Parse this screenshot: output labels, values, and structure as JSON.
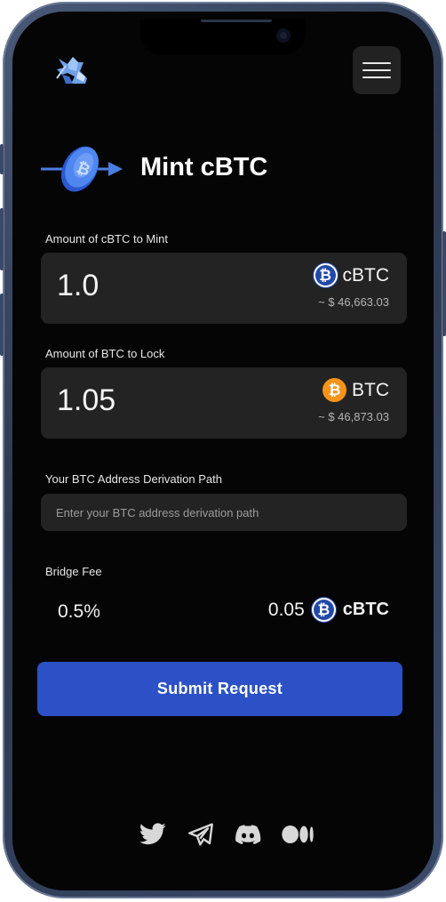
{
  "header": {
    "logo_icon": "knight-logo-icon",
    "menu_icon": "hamburger-menu-icon"
  },
  "page": {
    "title": "Mint cBTC",
    "title_icon": "mint-arrow-coin-icon"
  },
  "mint_amount": {
    "label": "Amount of cBTC to Mint",
    "value": "1.0",
    "token_symbol": "cBTC",
    "token_icon": "cbtc-coin-icon",
    "usd_value": "~ $ 46,663.03"
  },
  "lock_amount": {
    "label": "Amount of BTC to Lock",
    "value": "1.05",
    "token_symbol": "BTC",
    "token_icon": "btc-coin-icon",
    "usd_value": "~ $ 46,873.03"
  },
  "derivation_path": {
    "label": "Your BTC Address Derivation Path",
    "value": "",
    "placeholder": "Enter your BTC address derivation path"
  },
  "bridge_fee": {
    "label": "Bridge Fee",
    "percent": "0.5%",
    "amount": "0.05",
    "token_symbol": "cBTC",
    "token_icon": "cbtc-coin-icon"
  },
  "actions": {
    "submit_label": "Submit Request"
  },
  "footer": {
    "socials": [
      "twitter-icon",
      "telegram-icon",
      "discord-icon",
      "medium-icon"
    ]
  },
  "colors": {
    "background": "#050505",
    "card": "#232323",
    "accent": "#2c51c6",
    "cbtc": "#2249a8",
    "btc": "#f7931a",
    "frame": "#2c3850"
  }
}
